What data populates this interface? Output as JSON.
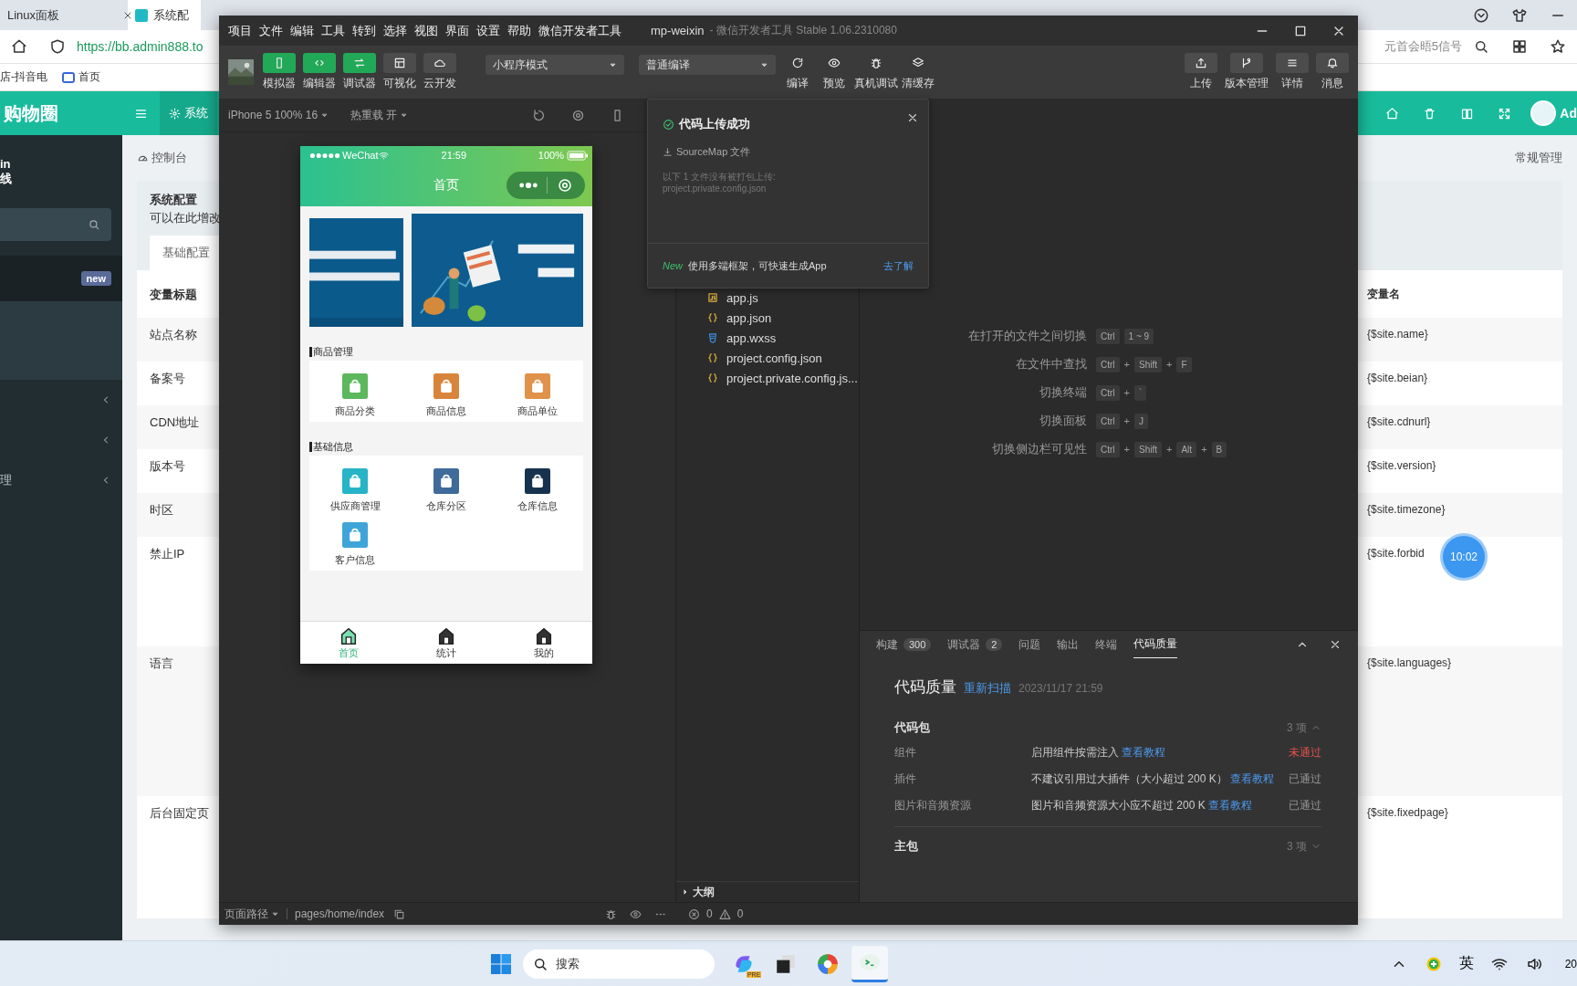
{
  "browser": {
    "tabs": [
      {
        "label": "Linux面板",
        "selected": false
      },
      {
        "label": "系统配",
        "selected": true
      }
    ],
    "url": "https://bb.admin888.to",
    "search_text": "元首会晤5信号",
    "bookmarks": [
      "店-抖音电",
      "首页"
    ]
  },
  "admin": {
    "logo": "购物圈",
    "header_tab": "系统",
    "header_user": "Ad",
    "user_name": "in",
    "user_status": "线",
    "sidebar_items": [
      {
        "badge": "new",
        "selected": true,
        "chevron": false
      },
      {
        "selected": false,
        "chevron": false
      },
      {
        "selected": false,
        "chevron": true
      },
      {
        "selected": false,
        "chevron": true
      },
      {
        "label": "理",
        "selected": false,
        "chevron": true
      }
    ],
    "breadcrumb": "控制台",
    "breadcrumb_right": "常规管理",
    "card_title": "系统配置",
    "card_subtitle": "可以在此增改",
    "tabs": [
      {
        "label": "基础配置",
        "selected": true
      }
    ],
    "columns": [
      "变量标题",
      "变量名"
    ],
    "rows": [
      {
        "title": "站点名称",
        "variable": "{$site.name}",
        "kind": "input"
      },
      {
        "title": "备案号",
        "variable": "{$site.beian}",
        "kind": "input"
      },
      {
        "title": "CDN地址",
        "variable": "{$site.cdnurl}",
        "kind": "input"
      },
      {
        "title": "版本号",
        "variable": "{$site.version}",
        "kind": "input"
      },
      {
        "title": "时区",
        "variable": "{$site.timezone}",
        "kind": "input"
      },
      {
        "title": "禁止IP",
        "variable": "{$site.forbid",
        "kind": "textarea"
      },
      {
        "title": "语言",
        "variable": "{$site.languages}",
        "kind": "array"
      },
      {
        "title": "后台固定页",
        "variable": "{$site.fixedpage}",
        "kind": "input"
      }
    ],
    "floating_clock": "10:02"
  },
  "devtools": {
    "menu": [
      "项目",
      "文件",
      "编辑",
      "工具",
      "转到",
      "选择",
      "视图",
      "界面",
      "设置",
      "帮助",
      "微信开发者工具"
    ],
    "title": "mp-weixin",
    "subtitle": "- 微信开发者工具 Stable 1.06.2310080",
    "mode_buttons": [
      {
        "label": "模拟器",
        "kind": "phone",
        "selected": true
      },
      {
        "label": "编辑器",
        "kind": "code",
        "selected": true
      },
      {
        "label": "调试器",
        "kind": "swap",
        "selected": true
      },
      {
        "label": "可视化",
        "kind": "layout",
        "selected": false
      },
      {
        "label": "云开发",
        "kind": "cloud",
        "selected": false
      }
    ],
    "mode_select": "小程序模式",
    "compile_select": "普通编译",
    "actions": [
      {
        "label": "编译",
        "kind": "refresh"
      },
      {
        "label": "预览",
        "kind": "eye"
      },
      {
        "label": "真机调试",
        "kind": "bug"
      },
      {
        "label": "清缓存",
        "kind": "layers"
      }
    ],
    "right_actions": [
      {
        "label": "上传",
        "kind": "upload"
      },
      {
        "label": "版本管理",
        "kind": "branch"
      },
      {
        "label": "详情",
        "kind": "list"
      },
      {
        "label": "消息",
        "kind": "bell"
      }
    ],
    "simulator": {
      "device": "iPhone 5 100% 16",
      "hot_reload": "热重载 开",
      "page_path_label": "页面路径",
      "page_path": "pages/home/index"
    },
    "phone": {
      "carrier": "WeChat",
      "time": "21:59",
      "battery": "100%",
      "nav_title": "首页",
      "sections": [
        {
          "title": "商品管理",
          "items": [
            {
              "label": "商品分类",
              "color": "#5cb85c"
            },
            {
              "label": "商品信息",
              "color": "#d9843b"
            },
            {
              "label": "商品单位",
              "color": "#e0914a"
            }
          ]
        },
        {
          "title": "基础信息",
          "items": [
            {
              "label": "供应商管理",
              "color": "#27b4c7"
            },
            {
              "label": "仓库分区",
              "color": "#3f6a9a"
            },
            {
              "label": "仓库信息",
              "color": "#17324f"
            },
            {
              "label": "客户信息",
              "color": "#3fa5d8"
            }
          ]
        }
      ],
      "tabbar": [
        {
          "label": "首页",
          "selected": true
        },
        {
          "label": "统计",
          "selected": false
        },
        {
          "label": "我的",
          "selected": false
        }
      ]
    },
    "files": [
      {
        "name": "app.js",
        "kind": "js"
      },
      {
        "name": "app.json",
        "kind": "json"
      },
      {
        "name": "app.wxss",
        "kind": "css"
      },
      {
        "name": "project.config.json",
        "kind": "json"
      },
      {
        "name": "project.private.config.js...",
        "kind": "json"
      }
    ],
    "outline": "大纲",
    "errors": "0",
    "warnings": "0",
    "shortcuts": [
      {
        "label": "在打开的文件之间切换",
        "keys": [
          {
            "text": "Ctrl",
            "kind": "key"
          },
          {
            "text": "1 ~ 9",
            "kind": "key"
          }
        ]
      },
      {
        "label": "在文件中查找",
        "keys": [
          {
            "text": "Ctrl",
            "kind": "key"
          },
          {
            "text": "+",
            "kind": "plus"
          },
          {
            "text": "Shift",
            "kind": "key"
          },
          {
            "text": "+",
            "kind": "plus"
          },
          {
            "text": "F",
            "kind": "key"
          }
        ]
      },
      {
        "label": "切换终端",
        "keys": [
          {
            "text": "Ctrl",
            "kind": "key"
          },
          {
            "text": "+",
            "kind": "plus"
          },
          {
            "text": "`",
            "kind": "key"
          }
        ]
      },
      {
        "label": "切换面板",
        "keys": [
          {
            "text": "Ctrl",
            "kind": "key"
          },
          {
            "text": "+",
            "kind": "plus"
          },
          {
            "text": "J",
            "kind": "key"
          }
        ]
      },
      {
        "label": "切换侧边栏可见性",
        "keys": [
          {
            "text": "Ctrl",
            "kind": "key"
          },
          {
            "text": "+",
            "kind": "plus"
          },
          {
            "text": "Shift",
            "kind": "key"
          },
          {
            "text": "+",
            "kind": "plus"
          },
          {
            "text": "Alt",
            "kind": "key"
          },
          {
            "text": "+",
            "kind": "plus"
          },
          {
            "text": "B",
            "kind": "key"
          }
        ]
      }
    ],
    "popup": {
      "title": "代码上传成功",
      "sourcemap": "SourceMap 文件",
      "note": "以下 1 文件没有被打包上传:",
      "file": "project.private.config.json",
      "new_tag": "New",
      "promo": "使用多端框架，可快速生成App",
      "link": "去了解"
    },
    "panel_tabs": [
      {
        "label": "构建",
        "count": "300",
        "selected": false
      },
      {
        "label": "调试器",
        "count": "2",
        "selected": false
      },
      {
        "label": "问题",
        "selected": false
      },
      {
        "label": "输出",
        "selected": false
      },
      {
        "label": "终端",
        "selected": false
      },
      {
        "label": "代码质量",
        "selected": true
      }
    ],
    "quality": {
      "title": "代码质量",
      "rescan": "重新扫描",
      "time": "2023/11/17 21:59",
      "groups": [
        {
          "name": "代码包",
          "count": "3 项",
          "expanded": true,
          "rows": [
            {
              "name": "组件",
              "desc": "启用组件按需注入",
              "link": "查看教程",
              "status": "未通过",
              "passed": false
            },
            {
              "name": "插件",
              "desc": "不建议引用过大插件（大小超过 200 K）",
              "link": "查看教程",
              "status": "已通过",
              "passed": true
            },
            {
              "name": "图片和音频资源",
              "desc": "图片和音频资源大小应不超过 200 K",
              "link": "查看教程",
              "status": "已通过",
              "passed": true
            }
          ]
        },
        {
          "name": "主包",
          "count": "3 项",
          "expanded": false
        }
      ]
    }
  },
  "taskbar": {
    "search_placeholder": "搜索",
    "apps": [
      {
        "kind": "copilot",
        "badge": "PRE",
        "selected": false
      },
      {
        "kind": "taskview",
        "selected": false
      },
      {
        "kind": "colorwheel",
        "selected": false
      },
      {
        "kind": "devtool",
        "selected": true
      }
    ],
    "ime": "英",
    "clock": "20"
  }
}
